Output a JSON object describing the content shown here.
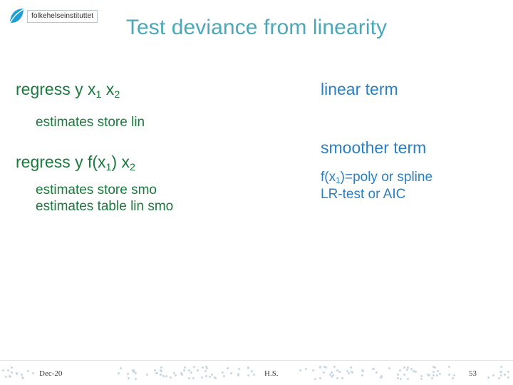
{
  "logo": {
    "text": "folkehelseinstituttet",
    "icon": "leaf-logo-icon"
  },
  "title": "Test deviance from linearity",
  "left_column": [
    {
      "type": "main",
      "parts": [
        {
          "t": "regress y x"
        },
        {
          "t": "1",
          "sub": true
        },
        {
          "t": " x"
        },
        {
          "t": "2",
          "sub": true
        }
      ]
    },
    {
      "type": "sub",
      "parts": [
        {
          "t": "estimates store lin"
        }
      ]
    },
    {
      "type": "main",
      "parts": [
        {
          "t": "regress y f(x"
        },
        {
          "t": "1",
          "sub": true
        },
        {
          "t": ") x"
        },
        {
          "t": "2",
          "sub": true
        }
      ]
    },
    {
      "type": "sub",
      "parts": [
        {
          "t": "estimates store smo"
        }
      ]
    },
    {
      "type": "sub",
      "parts": [
        {
          "t": "estimates table lin smo"
        }
      ]
    }
  ],
  "left_text": {
    "line1": "regress y x1 x2",
    "line2": "estimates store lin",
    "line3": "regress y f(x1) x2",
    "line4": "estimates store smo",
    "line5": "estimates table lin smo"
  },
  "right_text": {
    "line1": "linear term",
    "line2": "smoother term",
    "line3": "f(x1)=poly or spline",
    "line4": "LR-test or AIC"
  },
  "footer": {
    "date": "Dec-20",
    "author": "H.S.",
    "page": "53"
  },
  "colors": {
    "title": "#4aa8b8",
    "left_text": "#1a7a3c",
    "right_text": "#2a7fc4",
    "footer_dots": "#c9d7e4"
  }
}
